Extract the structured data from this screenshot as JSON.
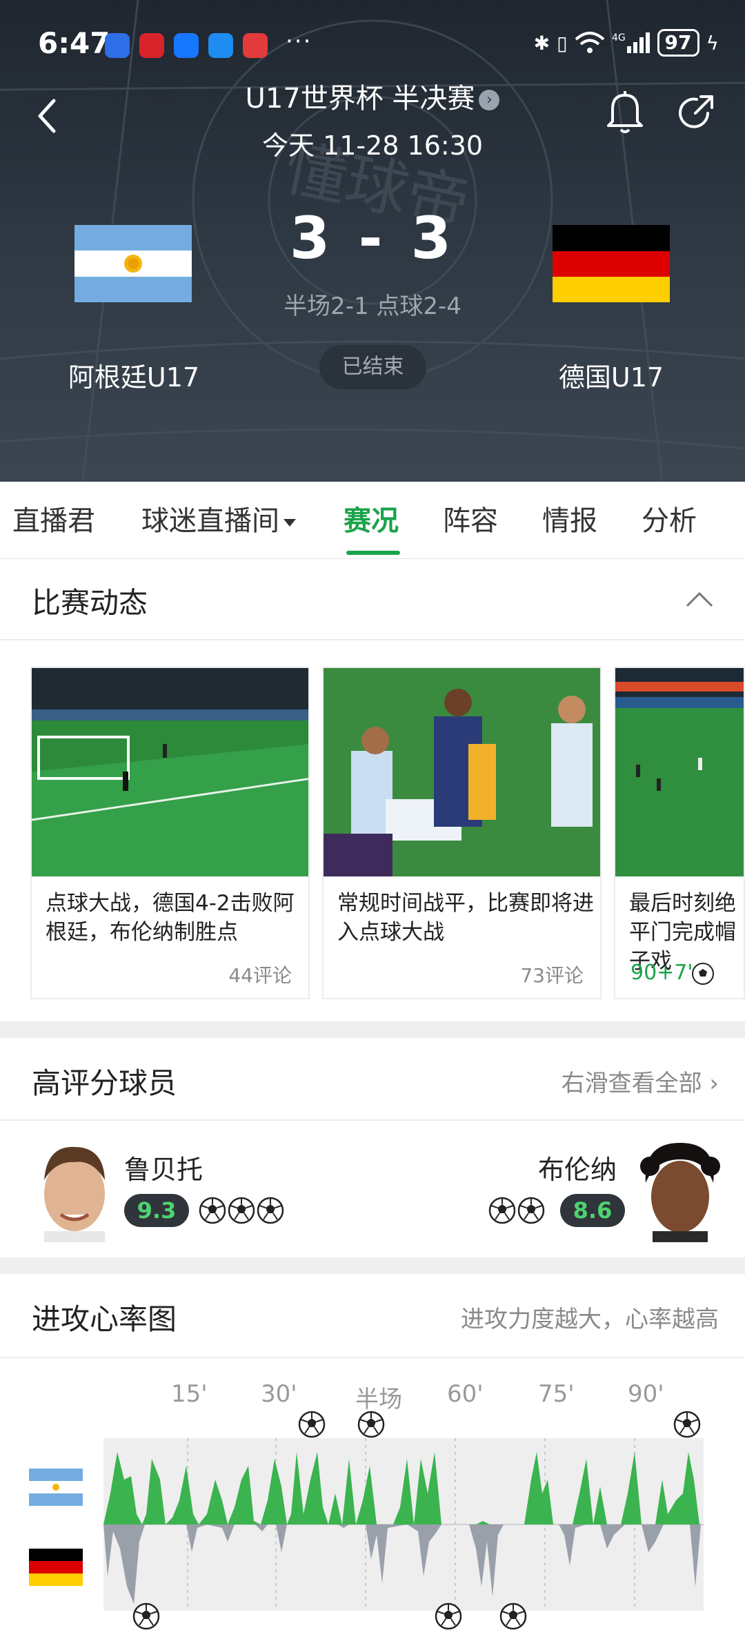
{
  "status_bar": {
    "time": "6:47",
    "dots": "···",
    "battery": "97"
  },
  "match": {
    "title": "U17世界杯 半决赛",
    "date": "今天 11-28 16:30",
    "score": "3 - 3",
    "sub": "半场2-1 点球2-4",
    "home": "阿根廷U17",
    "away": "德国U17",
    "state": "已结束"
  },
  "tabs": [
    "直播君",
    "球迷直播间",
    "赛况",
    "阵容",
    "情报",
    "分析"
  ],
  "active_tab": "赛况",
  "dynamics": {
    "title": "比赛动态",
    "cards": [
      {
        "text": "点球大战，德国4-2击败阿根廷，布伦纳制胜点",
        "comments": "44评论"
      },
      {
        "text": "常规时间战平，比赛即将进入点球大战",
        "comments": "73评论"
      },
      {
        "text": "最后时刻绝平门完成帽子戏",
        "minute": "90+7'"
      }
    ]
  },
  "top_players": {
    "title": "高评分球员",
    "more": "右滑查看全部",
    "left": {
      "name": "鲁贝托",
      "rating": "9.3",
      "goals": 3
    },
    "right": {
      "name": "布伦纳",
      "rating": "8.6",
      "goals": 2
    }
  },
  "attack": {
    "title": "进攻心率图",
    "hint": "进攻力度越大，心率越高",
    "ticks": [
      "15'",
      "30'",
      "半场",
      "60'",
      "75'",
      "90'"
    ]
  },
  "colors": {
    "accent": "#1aa34a",
    "header": "#303a45",
    "home_wave": "#3bb34e",
    "away_wave": "#9aa0aa"
  }
}
